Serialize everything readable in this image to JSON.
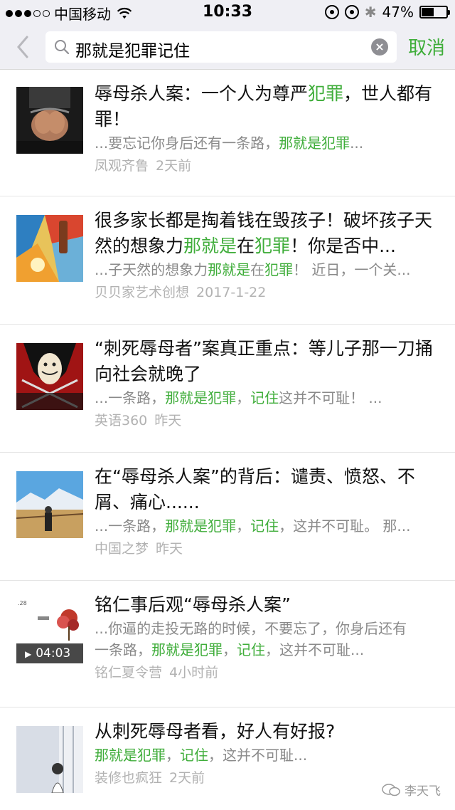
{
  "status_bar": {
    "carrier": "中国移动",
    "time": "10:33",
    "battery": "47%",
    "battery_level": 0.47
  },
  "search": {
    "query": "那就是犯罪记住",
    "cancel_label": "取消"
  },
  "results": [
    {
      "title": [
        [
          "辱母杀人案：一个人为尊严",
          false
        ],
        [
          "犯罪",
          true
        ],
        [
          "，世人都有罪！",
          false
        ]
      ],
      "snippet": [
        [
          "...要忘记你身后还有一条路，",
          false
        ],
        [
          "那就是犯罪",
          true
        ],
        [
          "...",
          false
        ]
      ],
      "source": "凤观齐鲁",
      "time": "2天前",
      "thumb": "handcuffed-hands"
    },
    {
      "title": [
        [
          "很多家长都是掏着钱在毁孩子！破坏孩子天然的想象力",
          false
        ],
        [
          "那就是",
          true
        ],
        [
          "在",
          false
        ],
        [
          "犯罪",
          true
        ],
        [
          "！你是否中...",
          false
        ]
      ],
      "snippet": [
        [
          "...子天然的想象力",
          false
        ],
        [
          "那就是",
          true
        ],
        [
          "在",
          false
        ],
        [
          "犯罪",
          true
        ],
        [
          "！ 近日，一个关...",
          false
        ]
      ],
      "source": "贝贝家艺术创想",
      "time": "2017-1-22",
      "thumb": "colorful-painting"
    },
    {
      "title": [
        [
          "“刺死辱母者”案真正重点：等儿子那一刀捅向社会就晚了",
          false
        ]
      ],
      "snippet": [
        [
          "...一条路，",
          false
        ],
        [
          "那就是犯罪",
          true
        ],
        [
          "，",
          false
        ],
        [
          "记住",
          true
        ],
        [
          "这并不可耻！ ...",
          false
        ]
      ],
      "source": "英语360",
      "time": "昨天",
      "thumb": "mask-swords"
    },
    {
      "title": [
        [
          "在“辱母杀人案”的背后：谴责、愤怒、不屑、痛心......",
          false
        ]
      ],
      "snippet": [
        [
          "...一条路，",
          false
        ],
        [
          "那就是犯罪",
          true
        ],
        [
          "，",
          false
        ],
        [
          "记住",
          true
        ],
        [
          "，这并不可耻。 那...",
          false
        ]
      ],
      "source": "中国之梦",
      "time": "昨天",
      "thumb": "landscape-person"
    },
    {
      "title": [
        [
          "铭仁事后观“辱母杀人案”",
          false
        ]
      ],
      "snippet_lines": [
        [
          [
            "...你逼的走投无路的时候，不要忘了，你身后还有",
            false
          ]
        ],
        [
          [
            "一条路，",
            false
          ],
          [
            "那就是犯罪",
            true
          ],
          [
            "，",
            false
          ],
          [
            "记住",
            true
          ],
          [
            "，这并不可耻...",
            false
          ]
        ]
      ],
      "source": "铭仁夏令营",
      "time": "4小时前",
      "thumb": "video-tree",
      "video_duration": "04:03",
      "thumb_caption": ".28"
    },
    {
      "title": [
        [
          "从刺死辱母者看，好人有好报?",
          false
        ]
      ],
      "snippet": [
        [
          "那就是犯罪",
          true
        ],
        [
          "，",
          false
        ],
        [
          "记住",
          true
        ],
        [
          "，这并不可耻...",
          false
        ]
      ],
      "source": "装修也疯狂",
      "time": "2天前",
      "thumb": "sketch-girl"
    }
  ],
  "watermark": "李天飞",
  "colors": {
    "accent": "#3fad3a",
    "meta": "#b2b2b2",
    "snippet": "#8a8a8a",
    "bar_bg": "#efeff4"
  }
}
